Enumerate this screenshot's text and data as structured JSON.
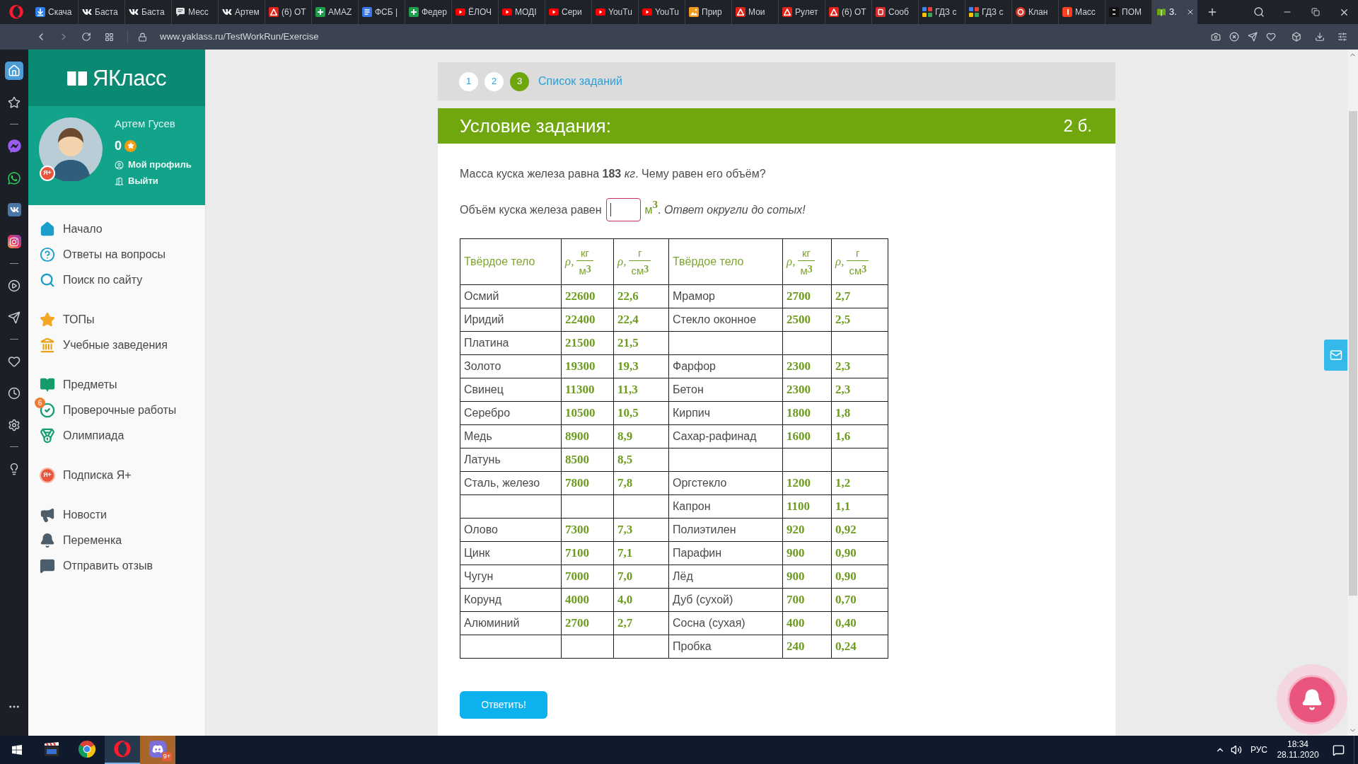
{
  "browser": {
    "tabs": [
      {
        "title": "Скача",
        "kind": "download",
        "selected": false
      },
      {
        "title": "Баста",
        "kind": "vk",
        "selected": false
      },
      {
        "title": "Баста",
        "kind": "vk",
        "selected": false
      },
      {
        "title": "Месс",
        "kind": "chat",
        "selected": false
      },
      {
        "title": "Артем",
        "kind": "vk",
        "selected": false
      },
      {
        "title": "(6) ОТ",
        "kind": "acrobat",
        "selected": false
      },
      {
        "title": "AMAZ",
        "kind": "sheet",
        "selected": false
      },
      {
        "title": "ФСБ |",
        "kind": "doc",
        "selected": false
      },
      {
        "title": "Федер",
        "kind": "sheet",
        "selected": false
      },
      {
        "title": "ЁЛОЧ",
        "kind": "youtube",
        "selected": false
      },
      {
        "title": "МОДІ",
        "kind": "youtube",
        "selected": false
      },
      {
        "title": "Сери",
        "kind": "youtube",
        "selected": false
      },
      {
        "title": "YouTu",
        "kind": "youtube",
        "selected": false
      },
      {
        "title": "YouTu",
        "kind": "youtube",
        "selected": false
      },
      {
        "title": "Прир",
        "kind": "photo",
        "selected": false
      },
      {
        "title": "Мои",
        "kind": "acrobat",
        "selected": false
      },
      {
        "title": "Рулет",
        "kind": "acrobat",
        "selected": false
      },
      {
        "title": "(6) ОТ",
        "kind": "acrobat",
        "selected": false
      },
      {
        "title": "Сооб",
        "kind": "letter",
        "selected": false
      },
      {
        "title": "ГДЗ с",
        "kind": "gdz",
        "selected": false
      },
      {
        "title": "ГДЗ с",
        "kind": "gdz",
        "selected": false
      },
      {
        "title": "Клан",
        "kind": "circle",
        "selected": false
      },
      {
        "title": "Масс",
        "kind": "yandex",
        "selected": false
      },
      {
        "title": "ПОМ",
        "kind": "number",
        "selected": false
      },
      {
        "title": "З.",
        "kind": "book",
        "selected": true
      }
    ],
    "url": "www.yaklass.ru/TestWorkRun/Exercise"
  },
  "browser_sidebar": {
    "groups": [
      [
        {
          "kind": "home",
          "selected": true
        },
        {
          "kind": "star",
          "selected": false
        }
      ],
      [
        {
          "kind": "messenger",
          "selected": false
        },
        {
          "kind": "whatsapp",
          "selected": false
        },
        {
          "kind": "vk",
          "selected": false
        },
        {
          "kind": "instagram",
          "selected": false
        }
      ],
      [
        {
          "kind": "player",
          "selected": false
        },
        {
          "kind": "send",
          "selected": false
        }
      ],
      [
        {
          "kind": "heart",
          "selected": false
        },
        {
          "kind": "history",
          "selected": false
        },
        {
          "kind": "settings",
          "selected": false
        }
      ],
      [
        {
          "kind": "tips",
          "selected": false
        }
      ]
    ]
  },
  "sidebar": {
    "logo": "ЯКласс",
    "user": {
      "name": "Артем Гусев",
      "points": "0",
      "badge": "Я+",
      "links": [
        {
          "kind": "profile",
          "label": "Мой профиль"
        },
        {
          "kind": "logout",
          "label": "Выйти"
        }
      ]
    },
    "menu": [
      [
        {
          "kind": "home",
          "label": "Начало"
        },
        {
          "kind": "help",
          "label": "Ответы на вопросы"
        },
        {
          "kind": "search",
          "label": "Поиск по сайту"
        }
      ],
      [
        {
          "kind": "top",
          "label": "ТОПы"
        },
        {
          "kind": "schools",
          "label": "Учебные заведения"
        }
      ],
      [
        {
          "kind": "subjects",
          "label": "Предметы"
        },
        {
          "kind": "tests",
          "label": "Проверочные работы",
          "badge": "6"
        },
        {
          "kind": "olympiad",
          "label": "Олимпиада"
        }
      ],
      [
        {
          "kind": "subscription",
          "label": "Подписка Я+",
          "icon_text": "Я+"
        }
      ],
      [
        {
          "kind": "news",
          "label": "Новости"
        },
        {
          "kind": "break",
          "label": "Переменка"
        },
        {
          "kind": "feedback",
          "label": "Отправить отзыв"
        }
      ]
    ]
  },
  "task": {
    "steps": [
      {
        "label": "1",
        "selected": false
      },
      {
        "label": "2",
        "selected": false
      },
      {
        "label": "3",
        "selected": true
      }
    ],
    "list_link": "Список заданий",
    "title": "Условие задания:",
    "points": "2 б.",
    "question": "Масса куска железа равна **183** *кг*. Чему равен его объём?",
    "answer_line": {
      "prefix": "Объём куска железа равен",
      "field": {
        "focused": true
      },
      "unit": "м$^{3}$",
      "suffix": ". *Ответ округли до сотых!*"
    },
    "table": {
      "columns": [
        {
          "kind": "text",
          "label": "Твёрдое тело"
        },
        {
          "kind": "fraction",
          "symbol": "ρ,",
          "numerator": "кг",
          "denominator": "м$^{3}$"
        },
        {
          "kind": "fraction",
          "symbol": "ρ,",
          "numerator": "г",
          "denominator": "см$^{3}$"
        },
        {
          "kind": "text",
          "label": "Твёрдое тело"
        },
        {
          "kind": "fraction",
          "symbol": "ρ,",
          "numerator": "кг",
          "denominator": "м$^{3}$"
        },
        {
          "kind": "fraction",
          "symbol": "ρ,",
          "numerator": "г",
          "denominator": "см$^{3}$"
        }
      ],
      "rows": [
        {
          "left": {
            "name": "Осмий",
            "kg_m3": "22600",
            "g_cm3": "22,6"
          },
          "right": {
            "name": "Мрамор",
            "kg_m3": "2700",
            "g_cm3": "2,7"
          }
        },
        {
          "left": {
            "name": "Иридий",
            "kg_m3": "22400",
            "g_cm3": "22,4"
          },
          "right": {
            "name": "Стекло оконное",
            "kg_m3": "2500",
            "g_cm3": "2,5"
          }
        },
        {
          "left": {
            "name": "Платина",
            "kg_m3": "21500",
            "g_cm3": "21,5"
          }
        },
        {
          "left": {
            "name": "Золото",
            "kg_m3": "19300",
            "g_cm3": "19,3"
          },
          "right": {
            "name": "Фарфор",
            "kg_m3": "2300",
            "g_cm3": "2,3"
          }
        },
        {
          "left": {
            "name": "Свинец",
            "kg_m3": "11300",
            "g_cm3": "11,3"
          },
          "right": {
            "name": "Бетон",
            "kg_m3": "2300",
            "g_cm3": "2,3"
          }
        },
        {
          "left": {
            "name": "Серебро",
            "kg_m3": "10500",
            "g_cm3": "10,5"
          },
          "right": {
            "name": "Кирпич",
            "kg_m3": "1800",
            "g_cm3": "1,8"
          }
        },
        {
          "left": {
            "name": "Медь",
            "kg_m3": "8900",
            "g_cm3": "8,9"
          },
          "right": {
            "name": "Сахар-рафинад",
            "kg_m3": "1600",
            "g_cm3": "1,6"
          }
        },
        {
          "left": {
            "name": "Латунь",
            "kg_m3": "8500",
            "g_cm3": "8,5"
          }
        },
        {
          "left": {
            "name": "Сталь, железо",
            "kg_m3": "7800",
            "g_cm3": "7,8"
          },
          "right": {
            "name": "Оргстекло",
            "kg_m3": "1200",
            "g_cm3": "1,2"
          }
        },
        {
          "right": {
            "name": "Капрон",
            "kg_m3": "1100",
            "g_cm3": "1,1"
          }
        },
        {
          "left": {
            "name": "Олово",
            "kg_m3": "7300",
            "g_cm3": "7,3"
          },
          "right": {
            "name": "Полиэтилен",
            "kg_m3": "920",
            "g_cm3": "0,92"
          }
        },
        {
          "left": {
            "name": "Цинк",
            "kg_m3": "7100",
            "g_cm3": "7,1"
          },
          "right": {
            "name": "Парафин",
            "kg_m3": "900",
            "g_cm3": "0,90"
          }
        },
        {
          "left": {
            "name": "Чугун",
            "kg_m3": "7000",
            "g_cm3": "7,0"
          },
          "right": {
            "name": "Лёд",
            "kg_m3": "900",
            "g_cm3": "0,90"
          }
        },
        {
          "left": {
            "name": "Корунд",
            "kg_m3": "4000",
            "g_cm3": "4,0"
          },
          "right": {
            "name": "Дуб (сухой)",
            "kg_m3": "700",
            "g_cm3": "0,70"
          }
        },
        {
          "left": {
            "name": "Алюминий",
            "kg_m3": "2700",
            "g_cm3": "2,7"
          },
          "right": {
            "name": "Сосна (сухая)",
            "kg_m3": "400",
            "g_cm3": "0,40"
          }
        },
        {
          "right": {
            "name": "Пробка",
            "kg_m3": "240",
            "g_cm3": "0,24"
          }
        }
      ]
    },
    "submit": "Ответить!"
  },
  "taskbar": {
    "apps": [
      {
        "kind": "media",
        "selected": false,
        "attention": false
      },
      {
        "kind": "chrome",
        "selected": false,
        "attention": false
      },
      {
        "kind": "opera",
        "selected": true,
        "attention": false
      },
      {
        "kind": "discord",
        "selected": false,
        "attention": true,
        "badge": "9+"
      }
    ],
    "language": "РУС",
    "time": "18:34",
    "date": "28.11.2020"
  }
}
